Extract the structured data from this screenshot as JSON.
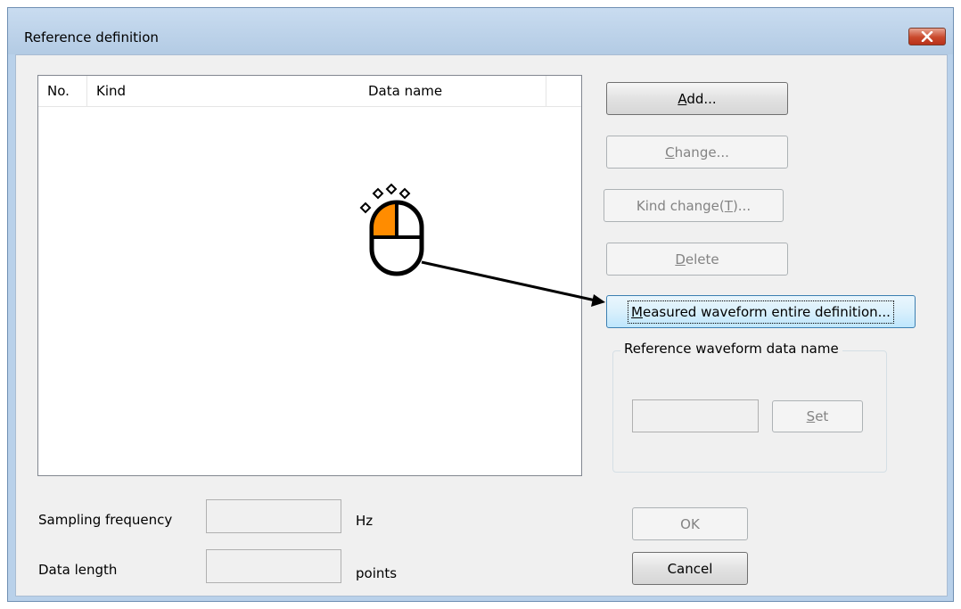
{
  "window": {
    "title": "Reference definition"
  },
  "list": {
    "columns": [
      "No.",
      "Kind",
      "Data name",
      ""
    ],
    "rows": []
  },
  "buttons": {
    "add": {
      "pre": "",
      "key": "A",
      "post": "dd..."
    },
    "change": {
      "pre": "",
      "key": "C",
      "post": "hange..."
    },
    "kind_change": {
      "pre": "Kind change(",
      "key": "T",
      "post": ")..."
    },
    "delete": {
      "pre": "",
      "key": "D",
      "post": "elete"
    },
    "measured": {
      "pre": "",
      "key": "M",
      "post": "easured waveform entire definition..."
    },
    "set": {
      "pre": "",
      "key": "S",
      "post": "et"
    },
    "ok": "OK",
    "cancel": "Cancel"
  },
  "group": {
    "label": "Reference waveform data name",
    "value": ""
  },
  "fields": {
    "sampling_frequency": {
      "label": "Sampling frequency",
      "value": "",
      "unit": "Hz"
    },
    "data_length": {
      "label": "Data length",
      "value": "",
      "unit": "points"
    }
  },
  "annotation": {
    "icon": "mouse-click-icon",
    "color": "#ff8c00"
  }
}
